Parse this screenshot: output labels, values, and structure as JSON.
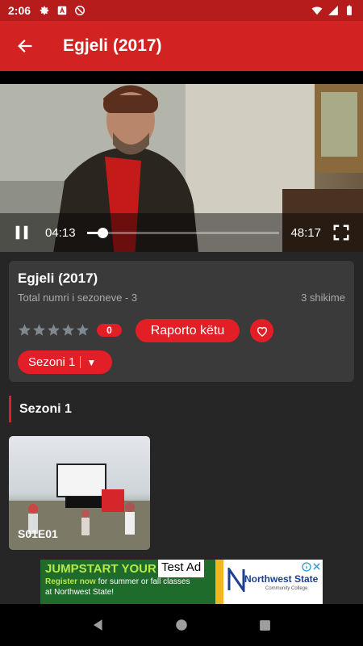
{
  "status_bar": {
    "time": "2:06",
    "icons": [
      "gear-icon",
      "a-box-icon",
      "no-disturb-icon",
      "wifi-icon",
      "signal-icon",
      "battery-icon"
    ]
  },
  "app_bar": {
    "title": "Egjeli (2017)",
    "back_icon": "arrow-left-icon"
  },
  "player": {
    "current_time": "04:13",
    "duration": "48:17",
    "progress": 0.08
  },
  "details": {
    "title": "Egjeli (2017)",
    "seasons_text": "Total numri i sezoneve - 3",
    "views": "3 shikime",
    "rating_stars": 0,
    "rating_count": "0",
    "report_label": "Raporto këtu",
    "season_select": "Sezoni 1",
    "dropdown_arrow": "▼"
  },
  "section": {
    "title": "Sezoni 1"
  },
  "episodes": [
    {
      "label": "S01E01"
    }
  ],
  "ad": {
    "tag": "Test Ad",
    "headline": "JUMPSTART YOUR F",
    "body_highlight": "Register now",
    "body": " for summer or fall classes at Northwest State!",
    "sponsor": "Northwest State",
    "sponsor_sub": "Community College"
  },
  "colors": {
    "accent": "#e21e26",
    "app_bar": "#d32222",
    "status_bar": "#b71c1c",
    "background": "#262626",
    "card": "#3a3a3a"
  }
}
